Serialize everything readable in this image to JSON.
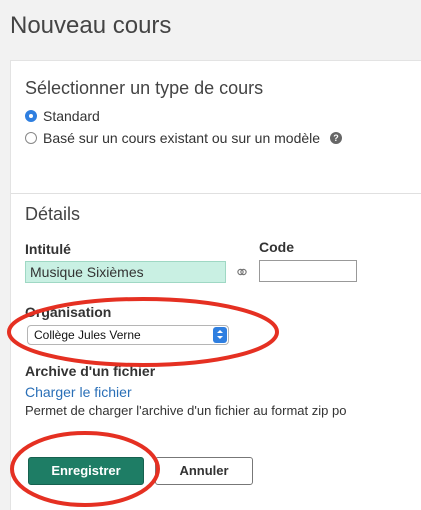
{
  "page": {
    "title": "Nouveau cours"
  },
  "course_type": {
    "heading": "Sélectionner un type de cours",
    "options": [
      {
        "label": "Standard",
        "selected": true
      },
      {
        "label": "Basé sur un cours existant ou sur un modèle",
        "selected": false
      }
    ],
    "help_icon": "question-circle-icon"
  },
  "details": {
    "heading": "Détails",
    "title_label": "Intitulé",
    "title_value": "Musique Sixièmes",
    "link_icon": "link-icon",
    "code_label": "Code",
    "code_value": "",
    "organisation_label": "Organisation",
    "organisation_selected": "Collège Jules Verne",
    "archive_label": "Archive d'un fichier",
    "upload_link": "Charger le fichier",
    "upload_help": "Permet de charger l'archive d'un fichier au format zip po"
  },
  "actions": {
    "save_label": "Enregistrer",
    "cancel_label": "Annuler"
  },
  "colors": {
    "accent": "#2f7fe0",
    "save_button": "#1e7d65",
    "title_field": "#c9f0e3",
    "annotation": "#e53022"
  }
}
